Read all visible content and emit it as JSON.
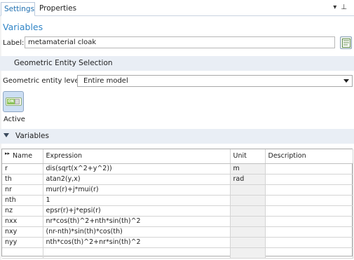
{
  "tabs": [
    {
      "label": "Settings"
    },
    {
      "label": "Properties"
    }
  ],
  "toolbar_icons": {
    "dropdown": "chevron-down-icon",
    "pin": "pin-icon"
  },
  "section_title": "Variables",
  "label_field": {
    "label": "Label:",
    "value": "metamaterial cloak",
    "button_icon": "show-expression-icon"
  },
  "geometric_entity_section": {
    "title": "Geometric Entity Selection"
  },
  "geometric_entity_level": {
    "label": "Geometric entity level:",
    "value": "Entire model"
  },
  "active_toggle": {
    "label": "Active",
    "badge": "ON",
    "state": true
  },
  "variables_section": {
    "title": "Variables"
  },
  "table": {
    "columns": [
      "Name",
      "Expression",
      "Unit",
      "Description"
    ],
    "rows": [
      {
        "name": "r",
        "expression": "dis(sqrt(x^2+y^2))",
        "unit": "m",
        "description": ""
      },
      {
        "name": "th",
        "expression": "atan2(y,x)",
        "unit": "rad",
        "description": ""
      },
      {
        "name": "nr",
        "expression": "mur(r)+j*mui(r)",
        "unit": "",
        "description": ""
      },
      {
        "name": "nth",
        "expression": "1",
        "unit": "",
        "description": ""
      },
      {
        "name": "nz",
        "expression": "epsr(r)+j*epsi(r)",
        "unit": "",
        "description": ""
      },
      {
        "name": "nxx",
        "expression": "nr*cos(th)^2+nth*sin(th)^2",
        "unit": "",
        "description": ""
      },
      {
        "name": "nxy",
        "expression": "(nr-nth)*sin(th)*cos(th)",
        "unit": "",
        "description": ""
      },
      {
        "name": "nyy",
        "expression": "nth*cos(th)^2+nr*sin(th)^2",
        "unit": "",
        "description": ""
      }
    ]
  },
  "colors": {
    "accent": "#2f84c6",
    "band": "#e9eef5",
    "unit_cell": "#f0f0f0",
    "active_bg": "#cddff3"
  }
}
